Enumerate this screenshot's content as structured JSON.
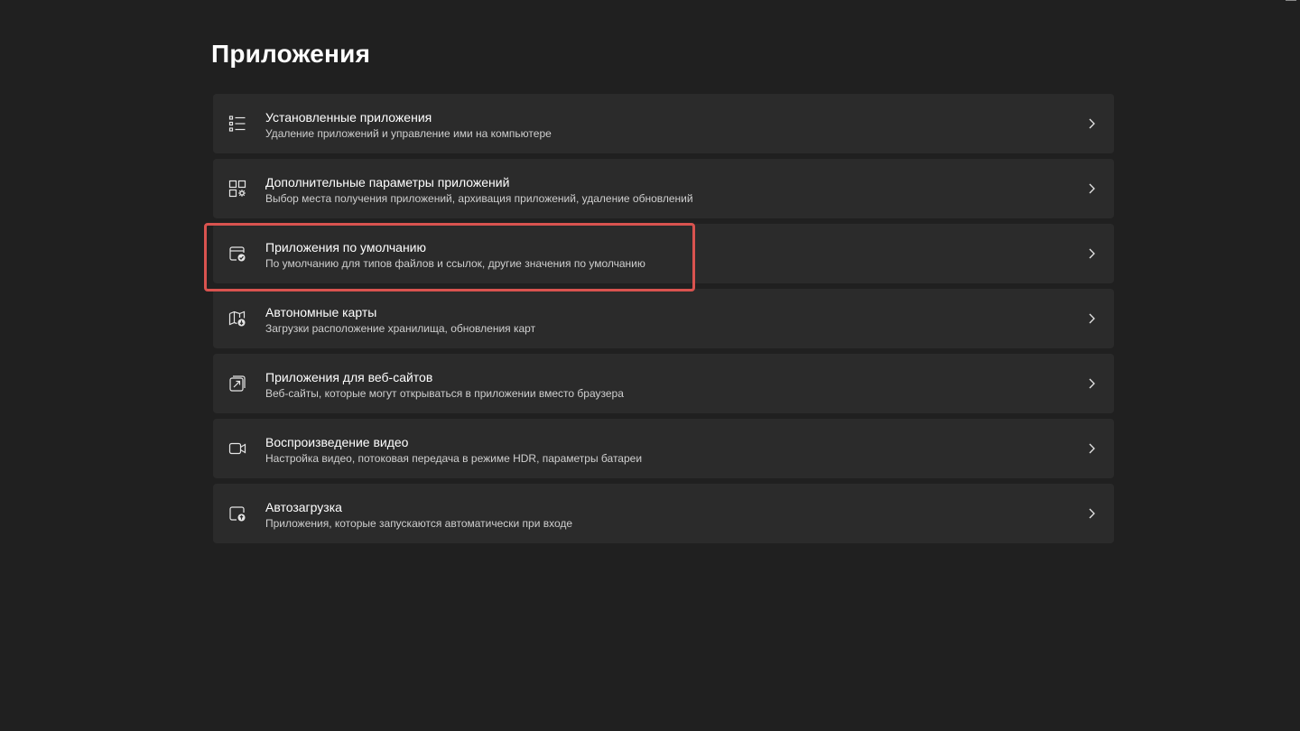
{
  "window": {
    "title": "Приложения"
  },
  "items": [
    {
      "icon": "installed-apps-list-icon",
      "title": "Установленные приложения",
      "subtitle": "Удаление приложений и управление ими на компьютере"
    },
    {
      "icon": "advanced-app-settings-icon",
      "title": "Дополнительные параметры приложений",
      "subtitle": "Выбор места получения приложений, архивация приложений, удаление обновлений"
    },
    {
      "icon": "default-apps-icon",
      "title": "Приложения по умолчанию",
      "subtitle": "По умолчанию для типов файлов и ссылок, другие значения по умолчанию"
    },
    {
      "icon": "offline-maps-icon",
      "title": "Автономные карты",
      "subtitle": "Загрузки расположение хранилища, обновления карт"
    },
    {
      "icon": "apps-for-websites-icon",
      "title": "Приложения для веб-сайтов",
      "subtitle": "Веб-сайты, которые могут открываться в приложении вместо браузера"
    },
    {
      "icon": "video-playback-icon",
      "title": "Воспроизведение видео",
      "subtitle": "Настройка видео, потоковая передача в режиме HDR, параметры батареи"
    },
    {
      "icon": "startup-apps-icon",
      "title": "Автозагрузка",
      "subtitle": "Приложения, которые запускаются автоматически при входе"
    }
  ],
  "highlight": {
    "target_item": "Приложения по умолчанию",
    "color": "#d9534f"
  },
  "colors": {
    "background": "#202020",
    "card": "#2b2b2b",
    "text": "#ffffff",
    "subtext": "#cfcfcf"
  }
}
